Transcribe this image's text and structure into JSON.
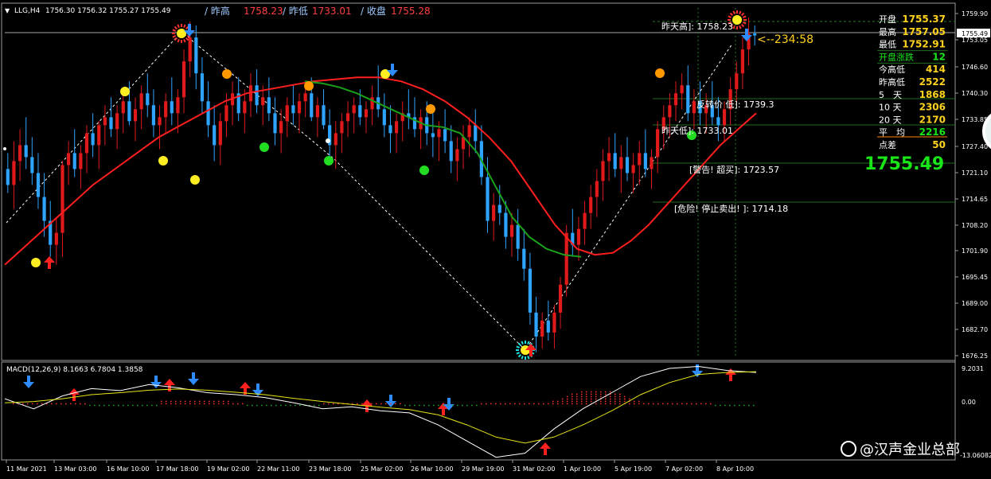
{
  "window": {
    "symbol_title": "LLG,H4",
    "ohlc_readout": "1756.30 1756.32 1755.27 1755.49",
    "header_items": [
      {
        "label": "/ 昨高",
        "value": "1758.23"
      },
      {
        "label": "/ 昨低",
        "value": "1733.01"
      },
      {
        "label": "/ 收盘",
        "value": "1755.28"
      }
    ]
  },
  "colors": {
    "background": "#000000",
    "bull": "#e0191b",
    "bear": "#2ea4ff",
    "ma_red": "#ff1e1e",
    "ma_green": "#1aa11a",
    "info_label": "#ffffff",
    "info_value_yellow": "#ffd21e",
    "info_value_green": "#19e619",
    "big_price": "#19e619",
    "grid": "#6b6b6b",
    "level_line": "#1f6d1f",
    "macd_line": "#ffffff",
    "signal_line": "#e6e619"
  },
  "price_axis": {
    "ticks": [
      "1759.90",
      "1753.05",
      "1746.60",
      "1740.30",
      "1733.85",
      "1727.40",
      "1721.10",
      "1714.65",
      "1708.20",
      "1701.90",
      "1695.45",
      "1689.00",
      "1682.70",
      "1676.25"
    ],
    "current_price": "1755.49"
  },
  "time_axis": {
    "ticks": [
      "11 Mar 2021",
      "13 Mar 03:00",
      "16 Mar 10:00",
      "17 Mar 18:00",
      "19 Mar 02:00",
      "22 Mar 11:00",
      "23 Mar 18:00",
      "25 Mar 02:00",
      "26 Mar 10:00",
      "29 Mar 19:00",
      "31 Mar 02:00",
      "1 Apr 10:00",
      "5 Apr 19:00",
      "7 Apr 02:00",
      "8 Apr 10:00"
    ]
  },
  "countdown": "<--234:58",
  "level_labels": [
    {
      "text": "昨天高]: 1758.23"
    },
    {
      "text": "反转价 低]: 1739.3"
    },
    {
      "text": "昨天低]: 1733.01"
    },
    {
      "text": "[警告! 超买]: 1723.57"
    },
    {
      "text": "[危险! 停止卖出! ]: 1714.18"
    }
  ],
  "info_panel": [
    {
      "label": "开盘",
      "value": "1755.37",
      "color": "yellow"
    },
    {
      "label": "最高",
      "value": "1757.05",
      "color": "yellow"
    },
    {
      "label": "最低",
      "value": "1752.91",
      "color": "yellow"
    },
    {
      "label": "开盘涨跌",
      "value": "12",
      "color": "green"
    },
    {
      "label": "今高低",
      "value": "414",
      "color": "yellow"
    },
    {
      "label": "昨高低",
      "value": "2522",
      "color": "yellow"
    },
    {
      "label": "5　天",
      "value": "1868",
      "color": "yellow"
    },
    {
      "label": "10 天",
      "value": "2306",
      "color": "yellow"
    },
    {
      "label": "20 天",
      "value": "2170",
      "color": "yellow"
    },
    {
      "label": "平　均",
      "value": "2216",
      "color": "green"
    },
    {
      "label": "点差",
      "value": "50",
      "color": "yellow"
    }
  ],
  "big_price": "1755.49",
  "macd_panel": {
    "title": "MACD(12,26,9) 8.1663 6.7804 1.3858",
    "axis_ticks": [
      "9.2031",
      "0.00",
      "-13.06082"
    ]
  },
  "watermark": "@汉声金业总部",
  "chart_data": {
    "type": "candlestick",
    "ylim": [
      1675.0,
      1762.0
    ],
    "candles": [
      [
        1722,
        1726,
        1716,
        1718
      ],
      [
        1718,
        1729,
        1712,
        1724
      ],
      [
        1724,
        1732,
        1719,
        1728
      ],
      [
        1728,
        1735,
        1722,
        1725
      ],
      [
        1725,
        1730,
        1718,
        1721
      ],
      [
        1721,
        1726,
        1712,
        1715
      ],
      [
        1715,
        1721,
        1705,
        1709
      ],
      [
        1709,
        1714,
        1700,
        1703
      ],
      [
        1703,
        1710,
        1698,
        1706
      ],
      [
        1706,
        1724,
        1700,
        1723
      ],
      [
        1723,
        1729,
        1718,
        1726
      ],
      [
        1726,
        1732,
        1720,
        1722
      ],
      [
        1722,
        1728,
        1717,
        1726
      ],
      [
        1726,
        1733,
        1721,
        1731
      ],
      [
        1731,
        1736,
        1725,
        1728
      ],
      [
        1728,
        1734,
        1722,
        1733
      ],
      [
        1733,
        1738,
        1728,
        1735
      ],
      [
        1735,
        1740,
        1730,
        1732
      ],
      [
        1732,
        1738,
        1727,
        1736
      ],
      [
        1736,
        1742,
        1731,
        1739
      ],
      [
        1739,
        1744,
        1733,
        1734
      ],
      [
        1734,
        1740,
        1729,
        1737
      ],
      [
        1737,
        1743,
        1732,
        1741
      ],
      [
        1741,
        1746,
        1735,
        1738
      ],
      [
        1738,
        1742,
        1730,
        1733
      ],
      [
        1733,
        1738,
        1727,
        1735
      ],
      [
        1735,
        1741,
        1731,
        1739
      ],
      [
        1739,
        1745,
        1733,
        1736
      ],
      [
        1736,
        1742,
        1731,
        1740
      ],
      [
        1740,
        1752,
        1736,
        1749
      ],
      [
        1749,
        1759,
        1745,
        1755
      ],
      [
        1755,
        1758,
        1742,
        1746
      ],
      [
        1746,
        1750,
        1736,
        1739
      ],
      [
        1739,
        1744,
        1730,
        1733
      ],
      [
        1733,
        1738,
        1724,
        1728
      ],
      [
        1728,
        1736,
        1723,
        1734
      ],
      [
        1734,
        1741,
        1730,
        1738
      ],
      [
        1738,
        1744,
        1733,
        1741
      ],
      [
        1741,
        1745,
        1734,
        1736
      ],
      [
        1736,
        1742,
        1731,
        1739
      ],
      [
        1739,
        1746,
        1735,
        1743
      ],
      [
        1743,
        1747,
        1736,
        1738
      ],
      [
        1738,
        1743,
        1733,
        1740
      ],
      [
        1740,
        1745,
        1734,
        1736
      ],
      [
        1736,
        1740,
        1728,
        1731
      ],
      [
        1731,
        1737,
        1726,
        1734
      ],
      [
        1734,
        1740,
        1730,
        1738
      ],
      [
        1738,
        1743,
        1733,
        1736
      ],
      [
        1736,
        1741,
        1731,
        1739
      ],
      [
        1739,
        1744,
        1735,
        1741
      ],
      [
        1741,
        1745,
        1734,
        1735
      ],
      [
        1735,
        1740,
        1730,
        1738
      ],
      [
        1738,
        1742,
        1732,
        1733
      ],
      [
        1733,
        1737,
        1725,
        1728
      ],
      [
        1728,
        1734,
        1722,
        1731
      ],
      [
        1731,
        1736,
        1726,
        1734
      ],
      [
        1734,
        1739,
        1730,
        1736
      ],
      [
        1736,
        1740,
        1731,
        1738
      ],
      [
        1738,
        1742,
        1733,
        1735
      ],
      [
        1735,
        1739,
        1731,
        1737
      ],
      [
        1737,
        1743,
        1733,
        1740
      ],
      [
        1740,
        1748,
        1735,
        1737
      ],
      [
        1737,
        1741,
        1730,
        1733
      ],
      [
        1733,
        1738,
        1726,
        1731
      ],
      [
        1731,
        1736,
        1726,
        1734
      ],
      [
        1734,
        1739,
        1729,
        1736
      ],
      [
        1736,
        1742,
        1732,
        1735
      ],
      [
        1735,
        1740,
        1730,
        1732
      ],
      [
        1732,
        1737,
        1727,
        1735
      ],
      [
        1735,
        1739,
        1728,
        1731
      ],
      [
        1731,
        1736,
        1725,
        1730
      ],
      [
        1730,
        1734,
        1724,
        1732
      ],
      [
        1732,
        1737,
        1726,
        1729
      ],
      [
        1729,
        1733,
        1721,
        1724
      ],
      [
        1724,
        1730,
        1719,
        1727
      ],
      [
        1727,
        1733,
        1722,
        1730
      ],
      [
        1730,
        1735,
        1725,
        1733
      ],
      [
        1733,
        1737,
        1726,
        1729
      ],
      [
        1729,
        1733,
        1718,
        1720
      ],
      [
        1720,
        1725,
        1706,
        1709
      ],
      [
        1709,
        1716,
        1704,
        1713
      ],
      [
        1713,
        1718,
        1708,
        1711
      ],
      [
        1711,
        1714,
        1702,
        1705
      ],
      [
        1705,
        1711,
        1700,
        1708
      ],
      [
        1708,
        1712,
        1699,
        1702
      ],
      [
        1702,
        1707,
        1694,
        1697
      ],
      [
        1697,
        1701,
        1683,
        1686
      ],
      [
        1686,
        1690,
        1676,
        1680
      ],
      [
        1680,
        1686,
        1677,
        1684
      ],
      [
        1684,
        1689,
        1679,
        1681
      ],
      [
        1681,
        1688,
        1677,
        1686
      ],
      [
        1686,
        1695,
        1682,
        1693
      ],
      [
        1693,
        1708,
        1690,
        1706
      ],
      [
        1706,
        1712,
        1700,
        1703
      ],
      [
        1703,
        1710,
        1699,
        1707
      ],
      [
        1707,
        1714,
        1703,
        1711
      ],
      [
        1711,
        1718,
        1707,
        1715
      ],
      [
        1715,
        1722,
        1710,
        1719
      ],
      [
        1719,
        1727,
        1714,
        1724
      ],
      [
        1724,
        1730,
        1719,
        1726
      ],
      [
        1726,
        1731,
        1720,
        1722
      ],
      [
        1722,
        1728,
        1716,
        1725
      ],
      [
        1725,
        1730,
        1719,
        1721
      ],
      [
        1721,
        1726,
        1716,
        1723
      ],
      [
        1723,
        1729,
        1718,
        1726
      ],
      [
        1726,
        1732,
        1720,
        1722
      ],
      [
        1722,
        1727,
        1717,
        1725
      ],
      [
        1725,
        1734,
        1721,
        1732
      ],
      [
        1732,
        1738,
        1727,
        1735
      ],
      [
        1735,
        1741,
        1730,
        1738
      ],
      [
        1738,
        1744,
        1734,
        1741
      ],
      [
        1741,
        1746,
        1737,
        1743
      ],
      [
        1743,
        1748,
        1734,
        1736
      ],
      [
        1736,
        1742,
        1732,
        1739
      ],
      [
        1739,
        1744,
        1733,
        1736
      ],
      [
        1736,
        1741,
        1731,
        1738
      ],
      [
        1738,
        1744,
        1733,
        1735
      ],
      [
        1735,
        1740,
        1729,
        1733
      ],
      [
        1733,
        1739,
        1729,
        1737
      ],
      [
        1737,
        1745,
        1733,
        1742
      ],
      [
        1742,
        1749,
        1738,
        1746
      ],
      [
        1746,
        1755,
        1742,
        1752
      ],
      [
        1752,
        1760,
        1748,
        1756
      ],
      [
        1756,
        1758,
        1753,
        1755.49
      ]
    ],
    "ma_red": [
      1698,
      1703,
      1708,
      1713,
      1718,
      1722,
      1726,
      1730,
      1733,
      1736,
      1739,
      1741,
      1742,
      1743,
      1744,
      1744.5,
      1745,
      1745,
      1744,
      1742,
      1739,
      1735,
      1730,
      1724,
      1716,
      1708,
      1702,
      1700.5,
      1701,
      1704,
      1708,
      1713,
      1718,
      1723,
      1728,
      1732,
      1736
    ],
    "ma_green": [
      1744,
      1743.5,
      1742.5,
      1741,
      1739,
      1737,
      1735,
      1733,
      1732.5,
      1731,
      1726,
      1718,
      1710,
      1705,
      1702,
      1700.5,
      1700
    ],
    "macd_line": [
      1.5,
      -1.0,
      2.2,
      4.0,
      3.5,
      5.0,
      4.2,
      3.0,
      2.5,
      1.8,
      0.5,
      -1.0,
      -0.5,
      -1.5,
      -2.0,
      -5.0,
      -9.0,
      -13.0,
      -12.0,
      -6.0,
      -1.0,
      3.0,
      7.0,
      9.0,
      9.5,
      8.5,
      8.0
    ],
    "signal_line": [
      0.5,
      0.8,
      1.5,
      2.5,
      3.0,
      3.6,
      3.9,
      3.6,
      3.1,
      2.5,
      1.6,
      0.8,
      0.1,
      -0.6,
      -1.2,
      -2.5,
      -5.0,
      -8.0,
      -9.5,
      -8.0,
      -5.0,
      -1.5,
      2.5,
      5.5,
      7.5,
      8.0,
      8.2
    ],
    "macd_ylim": [
      -13.06,
      9.2
    ]
  }
}
